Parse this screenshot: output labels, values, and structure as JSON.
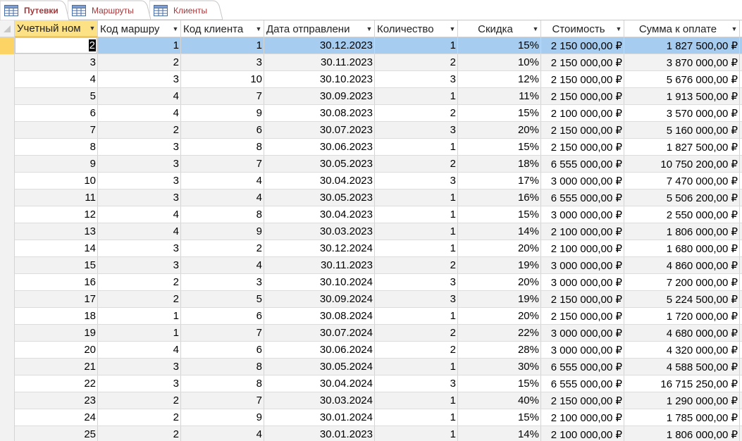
{
  "tabs": [
    {
      "label": "Путевки",
      "active": true
    },
    {
      "label": "Маршруты",
      "active": false
    },
    {
      "label": "Клиенты",
      "active": false
    }
  ],
  "colors": {
    "tab_text": "#a4373a",
    "selected_header": "#fde285",
    "current_row": "#a6ccef",
    "record_selector": "#fcd365"
  },
  "columns": [
    "Учетный ном",
    "Код маршру",
    "Код клиента",
    "Дата отправлени",
    "Количество",
    "Скидка",
    "Стоимость",
    "Сумма к оплате"
  ],
  "rows": [
    [
      "2",
      "1",
      "1",
      "30.12.2023",
      "1",
      "15%",
      "2 150 000,00 ₽",
      "1 827 500,00 ₽"
    ],
    [
      "3",
      "2",
      "3",
      "30.11.2023",
      "2",
      "10%",
      "2 150 000,00 ₽",
      "3 870 000,00 ₽"
    ],
    [
      "4",
      "3",
      "10",
      "30.10.2023",
      "3",
      "12%",
      "2 150 000,00 ₽",
      "5 676 000,00 ₽"
    ],
    [
      "5",
      "4",
      "7",
      "30.09.2023",
      "1",
      "11%",
      "2 150 000,00 ₽",
      "1 913 500,00 ₽"
    ],
    [
      "6",
      "4",
      "9",
      "30.08.2023",
      "2",
      "15%",
      "2 100 000,00 ₽",
      "3 570 000,00 ₽"
    ],
    [
      "7",
      "2",
      "6",
      "30.07.2023",
      "3",
      "20%",
      "2 150 000,00 ₽",
      "5 160 000,00 ₽"
    ],
    [
      "8",
      "3",
      "8",
      "30.06.2023",
      "1",
      "15%",
      "2 150 000,00 ₽",
      "1 827 500,00 ₽"
    ],
    [
      "9",
      "3",
      "7",
      "30.05.2023",
      "2",
      "18%",
      "6 555 000,00 ₽",
      "10 750 200,00 ₽"
    ],
    [
      "10",
      "3",
      "4",
      "30.04.2023",
      "3",
      "17%",
      "3 000 000,00 ₽",
      "7 470 000,00 ₽"
    ],
    [
      "11",
      "3",
      "4",
      "30.05.2023",
      "1",
      "16%",
      "6 555 000,00 ₽",
      "5 506 200,00 ₽"
    ],
    [
      "12",
      "4",
      "8",
      "30.04.2023",
      "1",
      "15%",
      "3 000 000,00 ₽",
      "2 550 000,00 ₽"
    ],
    [
      "13",
      "4",
      "9",
      "30.03.2023",
      "1",
      "14%",
      "2 100 000,00 ₽",
      "1 806 000,00 ₽"
    ],
    [
      "14",
      "3",
      "2",
      "30.12.2024",
      "1",
      "20%",
      "2 100 000,00 ₽",
      "1 680 000,00 ₽"
    ],
    [
      "15",
      "3",
      "4",
      "30.11.2023",
      "2",
      "19%",
      "3 000 000,00 ₽",
      "4 860 000,00 ₽"
    ],
    [
      "16",
      "2",
      "3",
      "30.10.2024",
      "3",
      "20%",
      "3 000 000,00 ₽",
      "7 200 000,00 ₽"
    ],
    [
      "17",
      "2",
      "5",
      "30.09.2024",
      "3",
      "19%",
      "2 150 000,00 ₽",
      "5 224 500,00 ₽"
    ],
    [
      "18",
      "1",
      "6",
      "30.08.2024",
      "1",
      "20%",
      "2 150 000,00 ₽",
      "1 720 000,00 ₽"
    ],
    [
      "19",
      "1",
      "7",
      "30.07.2024",
      "2",
      "22%",
      "3 000 000,00 ₽",
      "4 680 000,00 ₽"
    ],
    [
      "20",
      "4",
      "6",
      "30.06.2024",
      "2",
      "28%",
      "3 000 000,00 ₽",
      "4 320 000,00 ₽"
    ],
    [
      "21",
      "3",
      "8",
      "30.05.2024",
      "1",
      "30%",
      "6 555 000,00 ₽",
      "4 588 500,00 ₽"
    ],
    [
      "22",
      "3",
      "8",
      "30.04.2024",
      "3",
      "15%",
      "6 555 000,00 ₽",
      "16 715 250,00 ₽"
    ],
    [
      "23",
      "2",
      "7",
      "30.03.2024",
      "1",
      "40%",
      "2 150 000,00 ₽",
      "1 290 000,00 ₽"
    ],
    [
      "24",
      "2",
      "9",
      "30.01.2024",
      "1",
      "15%",
      "2 100 000,00 ₽",
      "1 785 000,00 ₽"
    ],
    [
      "25",
      "2",
      "4",
      "30.01.2023",
      "1",
      "14%",
      "2 100 000,00 ₽",
      "1 806 000,00 ₽"
    ]
  ]
}
